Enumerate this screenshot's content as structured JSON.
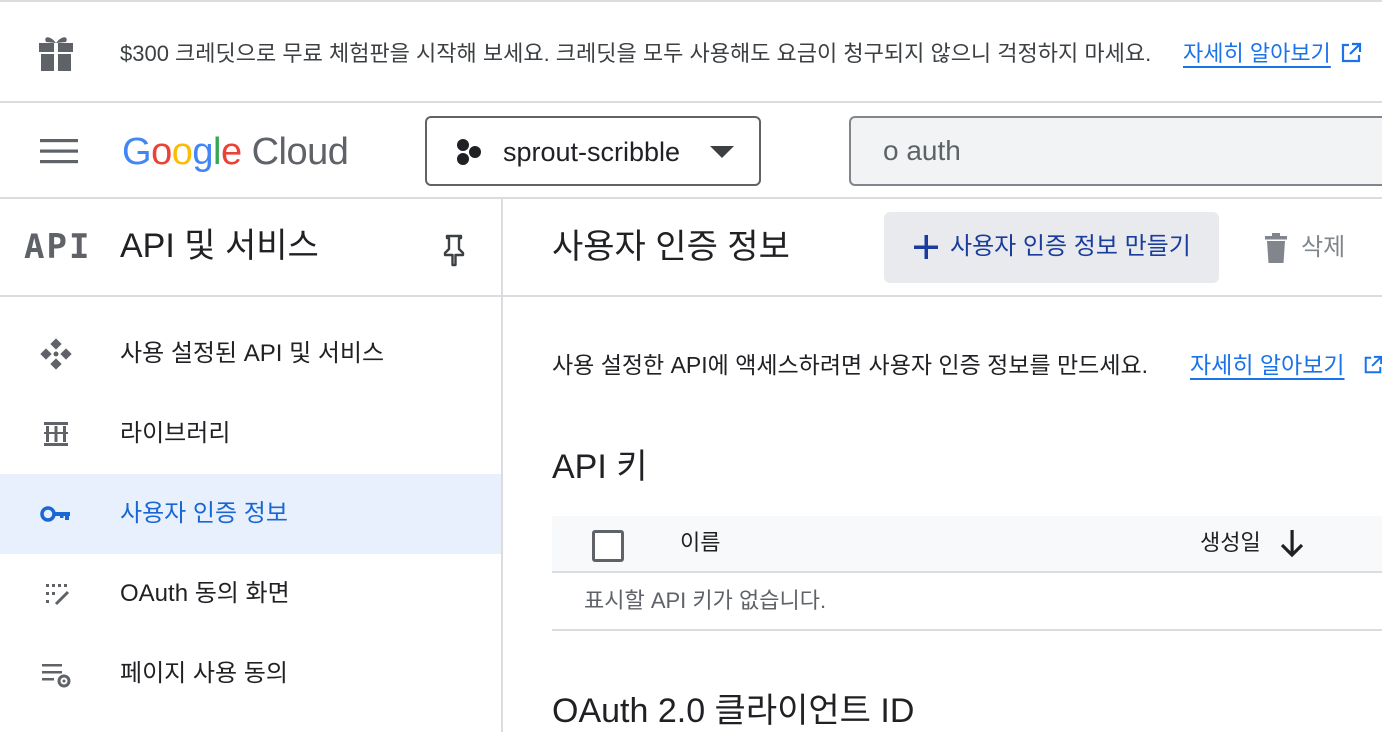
{
  "banner": {
    "message": "$300 크레딧으로 무료 체험판을 시작해 보세요. 크레딧을 모두 사용해도 요금이 청구되지 않으니 걱정하지 마세요.",
    "link_label": "자세히 알아보기",
    "icon": "gift-icon"
  },
  "header": {
    "logo": {
      "letters": [
        "G",
        "o",
        "o",
        "g",
        "l",
        "e"
      ],
      "letter_colors": [
        "#4285F4",
        "#EA4335",
        "#FBBC04",
        "#4285F4",
        "#34A853",
        "#EA4335"
      ],
      "product": "Cloud"
    },
    "project_name": "sprout-scribble",
    "search_value": "o auth"
  },
  "sidebar": {
    "badge": "API",
    "title": "API 및 서비스",
    "items": [
      {
        "label": "사용 설정된 API 및 서비스",
        "icon": "diamond-dots-icon",
        "active": false
      },
      {
        "label": "라이브러리",
        "icon": "library-icon",
        "active": false
      },
      {
        "label": "사용자 인증 정보",
        "icon": "key-icon",
        "active": true
      },
      {
        "label": "OAuth 동의 화면",
        "icon": "consent-screen-icon",
        "active": false
      },
      {
        "label": "페이지 사용 동의",
        "icon": "list-settings-icon",
        "active": false
      }
    ]
  },
  "main": {
    "title": "사용자 인증 정보",
    "create_label": "사용자 인증 정보 만들기",
    "delete_label": "삭제",
    "intro_text": "사용 설정한 API에 액세스하려면 사용자 인증 정보를 만드세요.",
    "intro_link": "자세히 알아보기",
    "api_keys": {
      "heading": "API 키",
      "columns": [
        "이름",
        "생성일"
      ],
      "empty_text": "표시할 API 키가 없습니다."
    },
    "oauth_heading": "OAuth 2.0 클라이언트 ID"
  },
  "colors": {
    "accent": "#1a73e8",
    "active_bg": "#e8f0fe",
    "active_text": "#1967d2",
    "divider": "#dadce0"
  }
}
